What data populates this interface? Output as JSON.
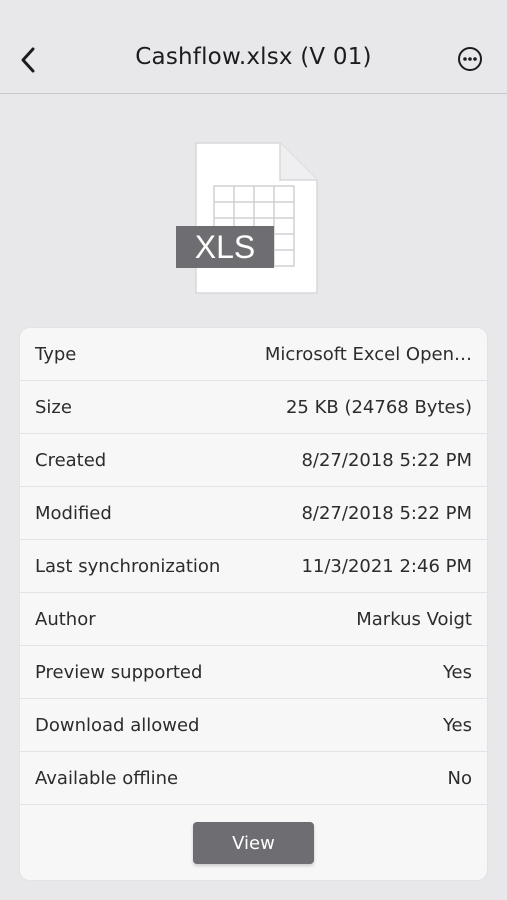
{
  "header": {
    "title": "Cashflow.xlsx (V 01)",
    "back_icon": "chevron-left-icon",
    "more_icon": "ellipsis-circle-icon"
  },
  "file_icon": {
    "badge": "XLS",
    "badge_color": "#6e6e72"
  },
  "details": [
    {
      "label": "Type",
      "value": "Microsoft Excel Open…"
    },
    {
      "label": "Size",
      "value": "25 KB (24768 Bytes)"
    },
    {
      "label": "Created",
      "value": "8/27/2018 5:22 PM"
    },
    {
      "label": "Modified",
      "value": "8/27/2018 5:22 PM"
    },
    {
      "label": "Last synchronization",
      "value": "11/3/2021 2:46 PM"
    },
    {
      "label": "Author",
      "value": "Markus Voigt"
    },
    {
      "label": "Preview supported",
      "value": "Yes"
    },
    {
      "label": "Download allowed",
      "value": "Yes"
    },
    {
      "label": "Available offline",
      "value": "No"
    }
  ],
  "actions": {
    "view_label": "View"
  },
  "colors": {
    "background": "#e8e8ea",
    "card": "#f7f7f8",
    "button": "#6e6e72"
  }
}
